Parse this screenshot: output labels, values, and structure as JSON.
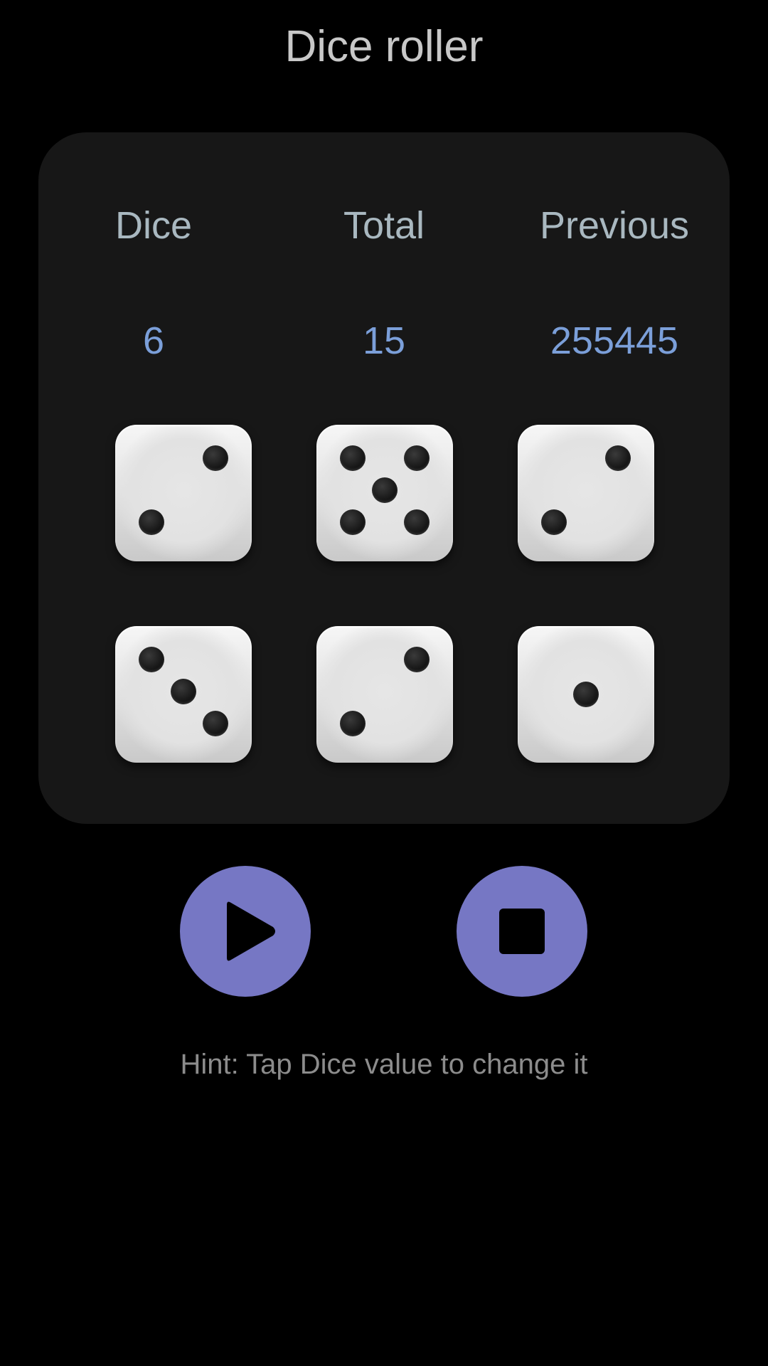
{
  "app": {
    "title": "Dice roller"
  },
  "stats": {
    "dice_label": "Dice",
    "total_label": "Total",
    "previous_label": "Previous",
    "dice_value": "6",
    "total_value": "15",
    "previous_value": "255445"
  },
  "dice": [
    {
      "value": 2
    },
    {
      "value": 5
    },
    {
      "value": 2
    },
    {
      "value": 3
    },
    {
      "value": 2
    },
    {
      "value": 1
    }
  ],
  "controls": {
    "play_icon": "play-icon",
    "stop_icon": "stop-icon",
    "accent_color": "#7677c4"
  },
  "hint": "Hint: Tap Dice value to change it"
}
